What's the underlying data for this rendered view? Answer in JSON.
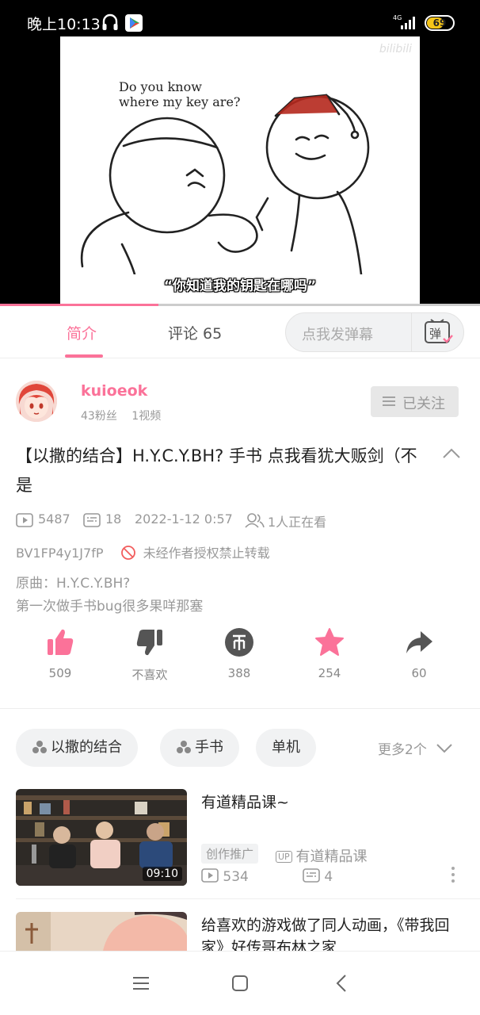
{
  "status_bar": {
    "time": "晚上10:13",
    "network": "4G",
    "battery": "69",
    "battery_level": 0.69
  },
  "video": {
    "watermark": "bilibili",
    "speech_line1": "Do you know",
    "speech_line2": "where my key are?",
    "subtitle": "“你知道我的钥匙在哪吗”",
    "progress": 0.33
  },
  "tabs": {
    "intro": "简介",
    "comments": "评论 65",
    "danmaku_placeholder": "点我发弹幕",
    "danmaku_icon_label": "弹"
  },
  "uploader": {
    "name": "kuioeok",
    "fans": "43粉丝",
    "videos": "1视频",
    "follow_label": "已关注"
  },
  "video_info": {
    "title": "【以撒的结合】H.Y.C.Y.BH? 手书 点我看犹大贩剑（不是",
    "plays": "5487",
    "danmaku_count": "18",
    "date": "2022-1-12 0:57",
    "watching": "1人正在看",
    "bvid": "BV1FP4y1J7fP",
    "copyright": "未经作者授权禁止转载",
    "desc_line1": "原曲：H.Y.C.Y.BH?",
    "desc_line2": "第一次做手书bug很多果咩那塞"
  },
  "actions": {
    "like_count": "509",
    "dislike_label": "不喜欢",
    "coin_count": "388",
    "favorite_count": "254",
    "share_count": "60"
  },
  "tags": {
    "items": [
      "以撒的结合",
      "手书",
      "单机"
    ],
    "more": "更多2个"
  },
  "related": [
    {
      "title": "有道精品课~",
      "promo_badge": "创作推广",
      "up_badge": "UP",
      "up_name": "有道精品课",
      "plays": "534",
      "danmaku": "4",
      "duration": "09:10"
    },
    {
      "title": "给喜欢的游戏做了同人动画，《带我回家》好传哥布林之家"
    }
  ],
  "colors": {
    "accent": "#fb7299",
    "muted": "#999999"
  }
}
